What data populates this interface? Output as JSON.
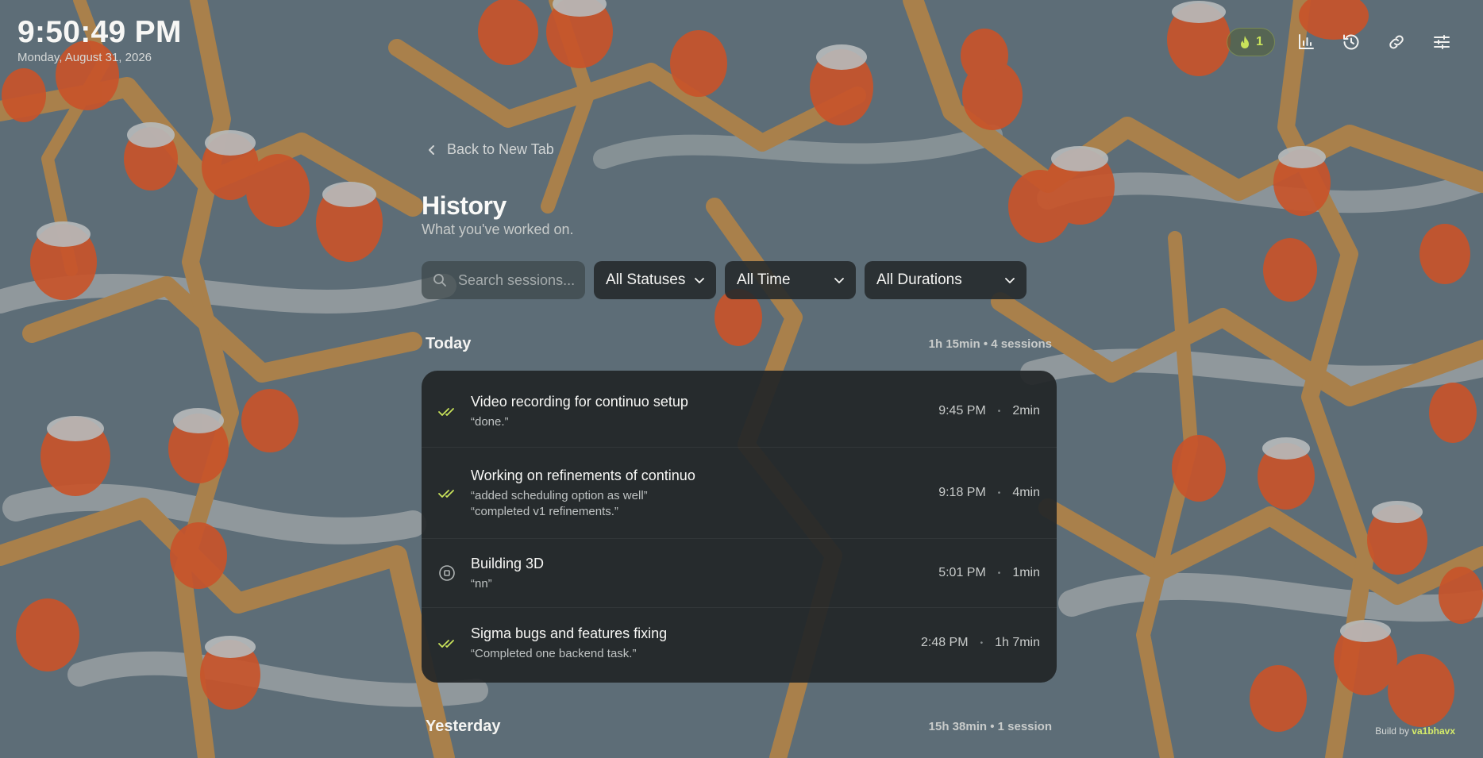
{
  "clock": {
    "time": "9:50:49 PM",
    "date": "Monday, August 31, 2026"
  },
  "toolbar": {
    "streak_count": "1",
    "icons": [
      "flame-icon",
      "stats-icon",
      "history-icon",
      "link-icon",
      "settings-sliders-icon"
    ]
  },
  "nav": {
    "back_label": "Back to New Tab"
  },
  "page": {
    "title": "History",
    "subtitle": "What you've worked on."
  },
  "filters": {
    "search_placeholder": "Search sessions...",
    "status": "All Statuses",
    "time": "All Time",
    "duration": "All Durations"
  },
  "groups": [
    {
      "title": "Today",
      "meta": "1h 15min • 4 sessions",
      "sessions": [
        {
          "name": "Video recording for continuo setup",
          "notes": [
            "“done.”"
          ],
          "time": "9:45 PM",
          "duration": "2min",
          "status": "completed"
        },
        {
          "name": "Working on refinements of continuo",
          "notes": [
            "“added scheduling option as well”",
            "“completed v1 refinements.”"
          ],
          "time": "9:18 PM",
          "duration": "4min",
          "status": "completed"
        },
        {
          "name": "Building 3D",
          "notes": [
            "“nn”"
          ],
          "time": "5:01 PM",
          "duration": "1min",
          "status": "stopped"
        },
        {
          "name": "Sigma bugs and features fixing",
          "notes": [
            "“Completed one backend task.”"
          ],
          "time": "2:48 PM",
          "duration": "1h 7min",
          "status": "completed"
        }
      ]
    },
    {
      "title": "Yesterday",
      "meta": "15h 38min • 1 session"
    }
  ],
  "footer": {
    "build_prefix": "Build by",
    "build_author": "va1bhavx"
  },
  "colors": {
    "accent": "#c9e35a",
    "card_bg": "#222628",
    "sky": "#5f6f78",
    "berry": "#c8542a",
    "branch": "#b08548"
  }
}
